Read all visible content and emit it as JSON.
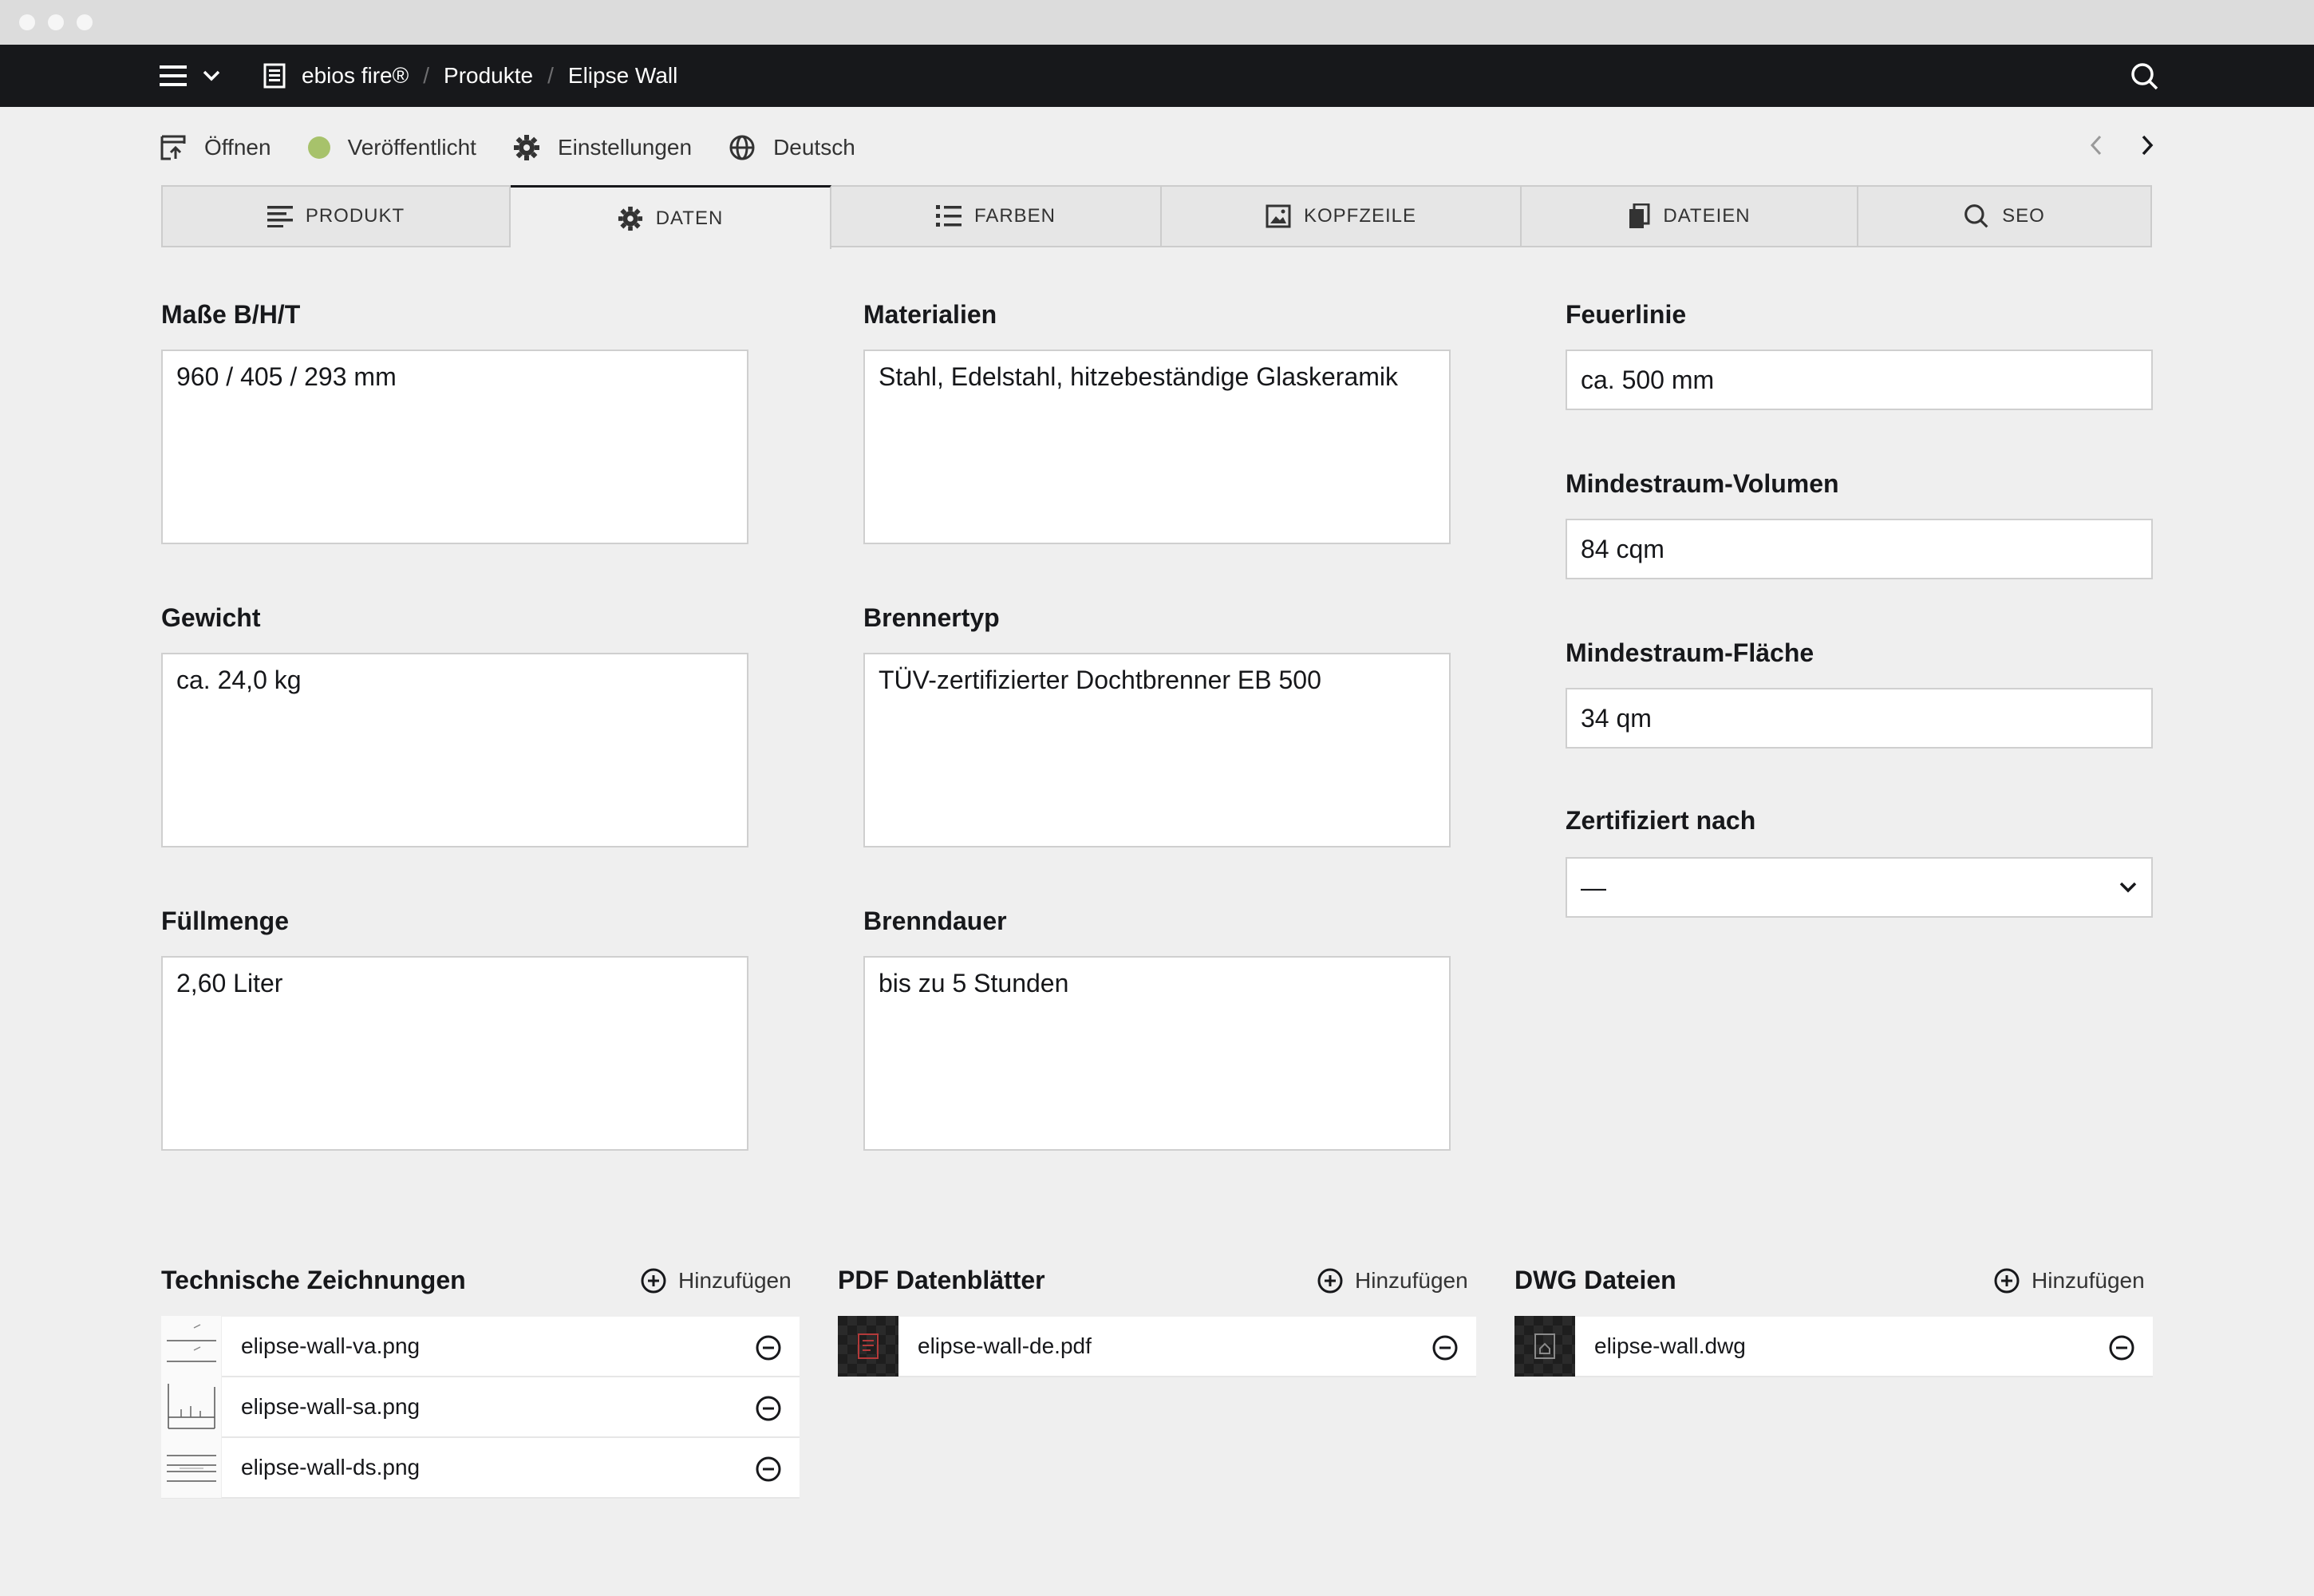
{
  "breadcrumbs": [
    "ebios fire®",
    "Produkte",
    "Elipse Wall"
  ],
  "toolbar": {
    "open": "Öffnen",
    "status": "Veröffentlicht",
    "status_color": "#a7c26b",
    "settings": "Einstellungen",
    "language": "Deutsch"
  },
  "tabs": [
    {
      "label": "PRODUKT",
      "icon": "text-lines-icon"
    },
    {
      "label": "DATEN",
      "icon": "gear-icon",
      "active": true
    },
    {
      "label": "FARBEN",
      "icon": "list-icon"
    },
    {
      "label": "KOPFZEILE",
      "icon": "image-icon"
    },
    {
      "label": "DATEIEN",
      "icon": "files-icon"
    },
    {
      "label": "SEO",
      "icon": "search-icon"
    }
  ],
  "fields": {
    "masse": {
      "label": "Maße B/H/T",
      "value": "960 / 405 / 293 mm"
    },
    "materialien": {
      "label": "Materialien",
      "value": "Stahl, Edelstahl, hitzebeständige Glaskeramik"
    },
    "feuerlinie": {
      "label": "Feuerlinie",
      "value": "ca. 500 mm"
    },
    "gewicht": {
      "label": "Gewicht",
      "value": "ca. 24,0 kg"
    },
    "brennertyp": {
      "label": "Brennertyp",
      "value": "TÜV-zertifizierter Dochtbrenner EB 500"
    },
    "volumen": {
      "label": "Mindestraum-Volumen",
      "value": "84 cqm"
    },
    "flaeche": {
      "label": "Mindestraum-Fläche",
      "value": "34 qm"
    },
    "zertifiziert": {
      "label": "Zertifiziert nach",
      "value": "—"
    },
    "fuellmenge": {
      "label": "Füllmenge",
      "value": "2,60 Liter"
    },
    "brenndauer": {
      "label": "Brenndauer",
      "value": "bis zu 5 Stunden"
    }
  },
  "sections": {
    "zeichnungen": {
      "title": "Technische Zeichnungen",
      "add": "Hinzufügen",
      "files": [
        "elipse-wall-va.png",
        "elipse-wall-sa.png",
        "elipse-wall-ds.png"
      ]
    },
    "pdf": {
      "title": "PDF Datenblätter",
      "add": "Hinzufügen",
      "files": [
        "elipse-wall-de.pdf"
      ]
    },
    "dwg": {
      "title": "DWG Dateien",
      "add": "Hinzufügen",
      "files": [
        "elipse-wall.dwg"
      ]
    }
  }
}
